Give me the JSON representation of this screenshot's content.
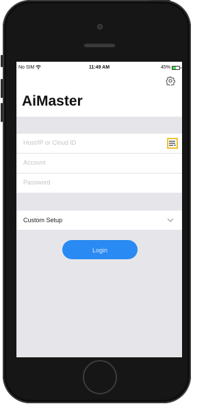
{
  "status_bar": {
    "carrier": "No SIM",
    "time": "11:49 AM",
    "battery_percent": "45%",
    "battery_level": 0.45,
    "wifi_icon": "wifi-icon"
  },
  "header": {
    "title": "AiMaster",
    "settings_icon": "gear-icon"
  },
  "login_form": {
    "host_placeholder": "Host/IP or Cloud ID",
    "account_placeholder": "Account",
    "password_placeholder": "Password",
    "host_list_icon": "list-icon"
  },
  "custom_setup": {
    "label": "Custom Setup",
    "icon": "chevron-down-icon"
  },
  "login_button": {
    "label": "Login"
  },
  "colors": {
    "accent": "#2a8af3",
    "highlight": "#f2c12e",
    "background": "#e6e6ea"
  }
}
